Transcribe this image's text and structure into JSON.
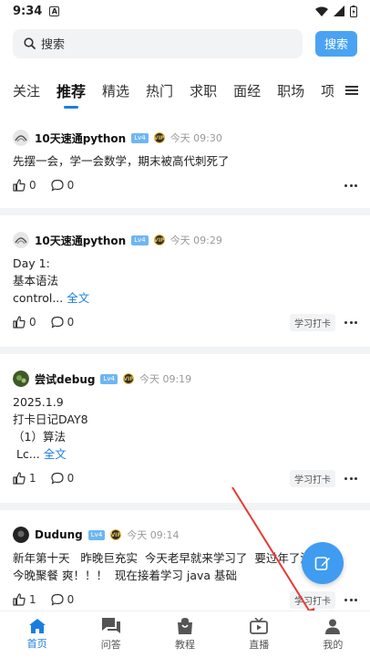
{
  "status_bar": {
    "time": "9:34",
    "notif_glyph": "A"
  },
  "search": {
    "placeholder": "搜索",
    "button_label": "搜索"
  },
  "tabs": [
    {
      "label": "关注"
    },
    {
      "label": "推荐"
    },
    {
      "label": "精选"
    },
    {
      "label": "热门"
    },
    {
      "label": "求职"
    },
    {
      "label": "面经"
    },
    {
      "label": "职场"
    },
    {
      "label": "项目"
    }
  ],
  "posts": [
    {
      "author": "10天速通python",
      "level": "Lv4",
      "vip": "VIP",
      "time": "今天 09:30",
      "lines": [
        "先摆一会，学一会数学，期末被高代刺死了"
      ],
      "more": "",
      "likes": "0",
      "comments": "0",
      "tag": ""
    },
    {
      "author": "10天速通python",
      "level": "Lv4",
      "vip": "VIP",
      "time": "今天 09:29",
      "lines": [
        "Day 1:",
        "基本语法",
        "control..."
      ],
      "more": "全文",
      "likes": "0",
      "comments": "0",
      "tag": "学习打卡"
    },
    {
      "author": "尝试debug",
      "level": "Lv4",
      "vip": "VIP",
      "time": "今天 09:19",
      "lines": [
        "2025.1.9",
        "打卡日记DAY8",
        "（1）算法",
        " Lc..."
      ],
      "more": "全文",
      "likes": "1",
      "comments": "0",
      "tag": "学习打卡"
    },
    {
      "author": "Dudung",
      "level": "Lv4",
      "vip": "VIP",
      "time": "今天 09:14",
      "lines": [
        "新年第十天   昨晚巨充实  今天老早就来学习了  要过年了没有了",
        "今晚聚餐 爽！！！  现在接着学习 java 基础"
      ],
      "more": "",
      "likes": "1",
      "comments": "0",
      "tag": "学习打卡"
    }
  ],
  "bottom_nav": [
    {
      "label": "首页"
    },
    {
      "label": "问答"
    },
    {
      "label": "教程"
    },
    {
      "label": "直播"
    },
    {
      "label": "我的"
    }
  ],
  "colors": {
    "accent": "#1a7ee0",
    "search_button": "#4aa3f2",
    "fab": "#3f9cf0",
    "annotation_arrow": "#e53935"
  }
}
